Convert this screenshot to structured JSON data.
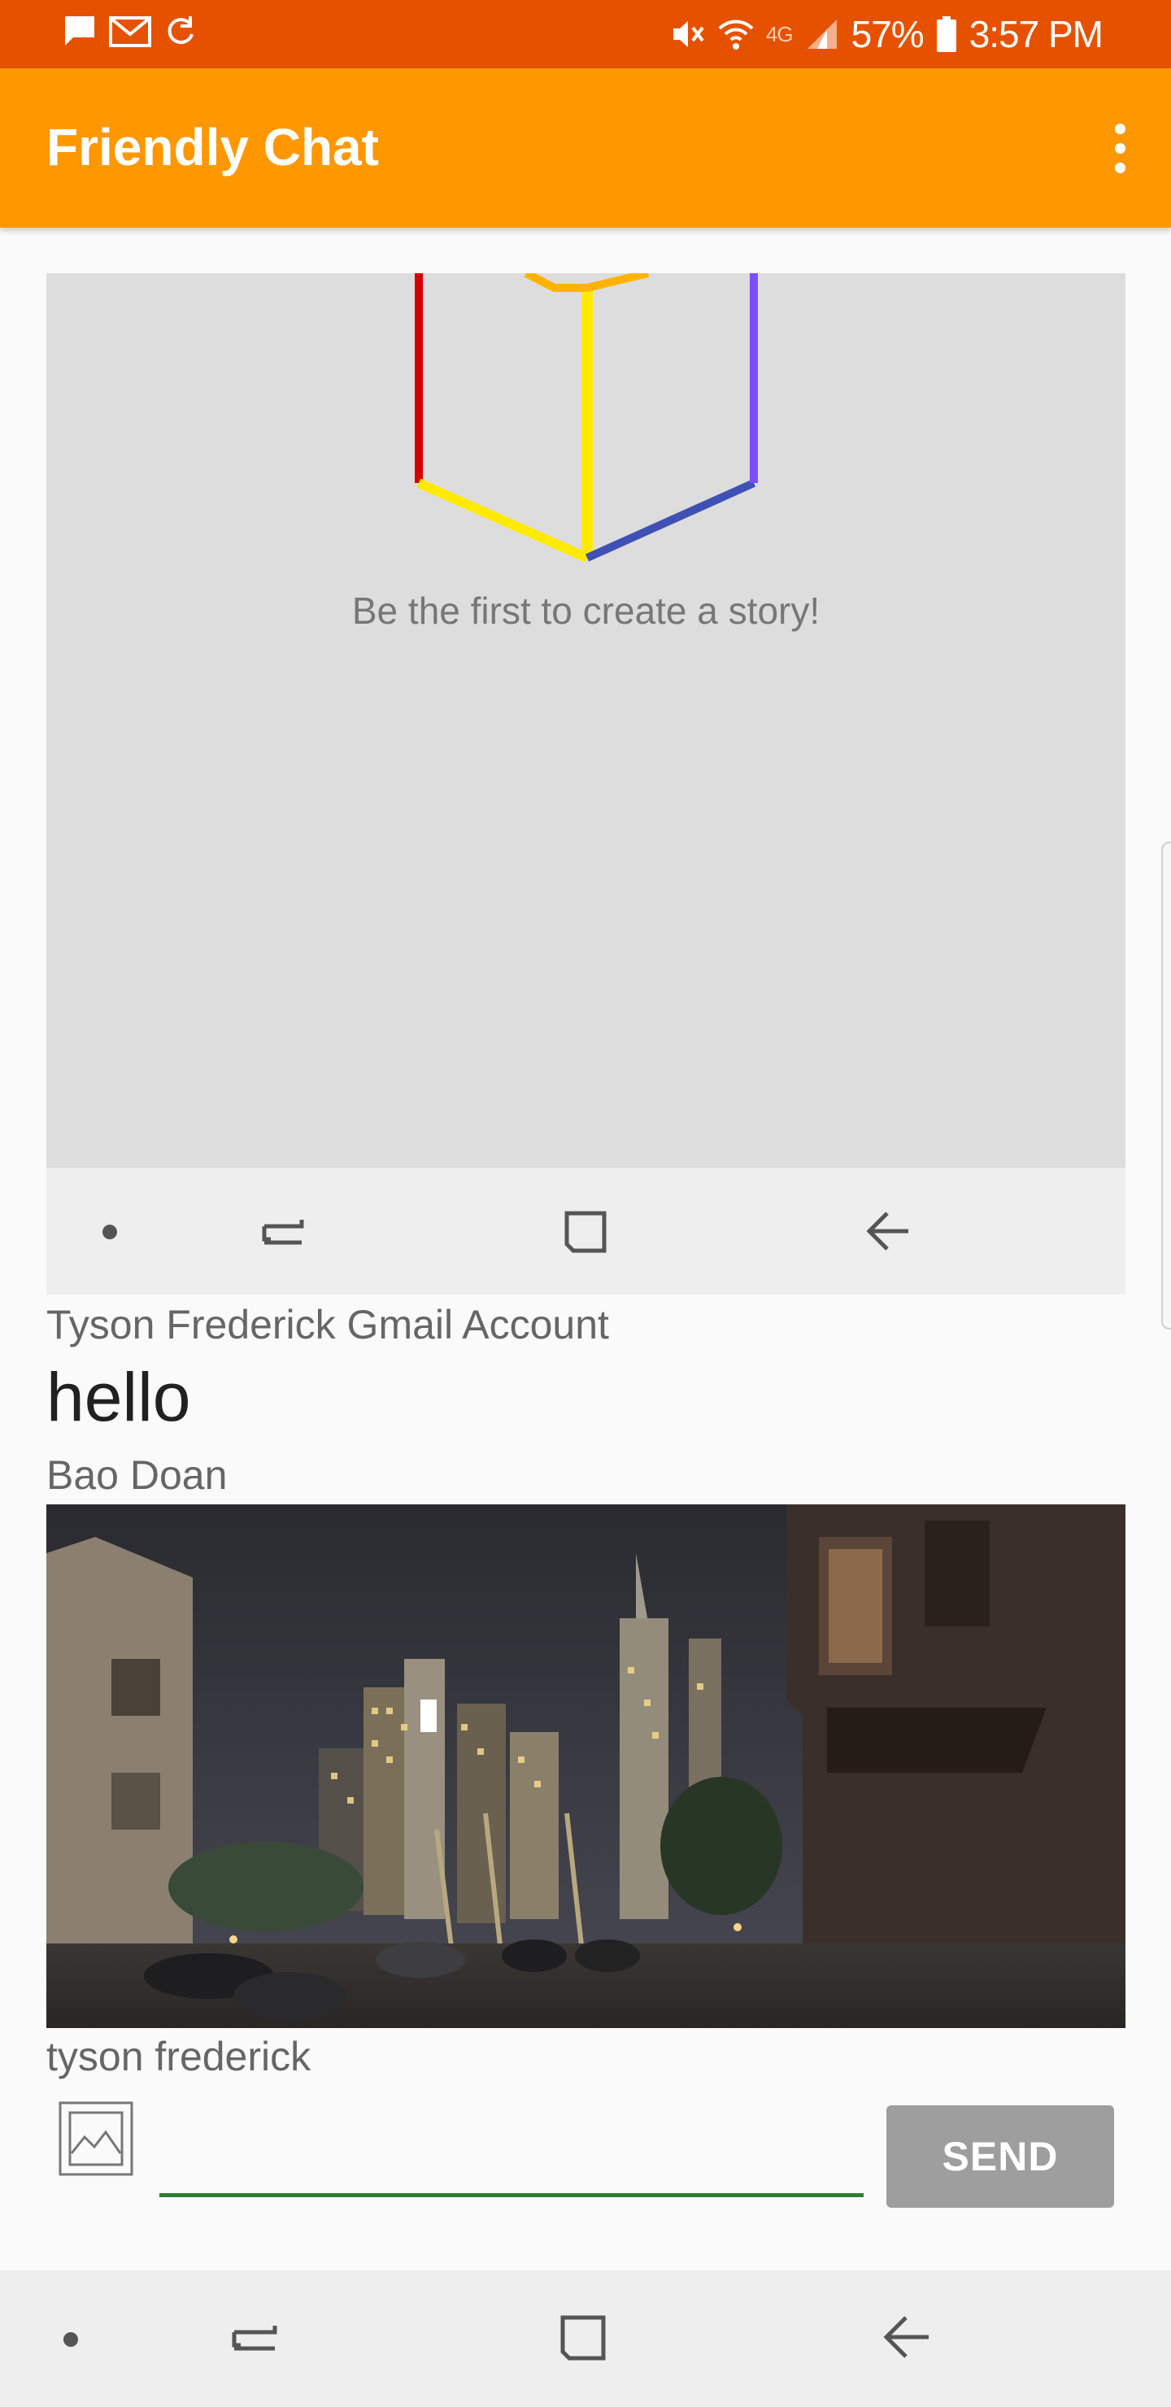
{
  "status_bar": {
    "battery": "57%",
    "time": "3:57 PM",
    "network": "4G",
    "icons_left": [
      "message-icon",
      "gmail-icon",
      "sync-icon"
    ],
    "icons_right": [
      "mute-icon",
      "wifi-icon",
      "signal-icon",
      "battery-icon"
    ]
  },
  "app_bar": {
    "title": "Friendly Chat",
    "menu_icon": "overflow-menu-icon"
  },
  "messages": [
    {
      "type": "image",
      "content": {
        "story_prompt": "Be the first to create a story!",
        "illustration": "rainbow-cube-icon",
        "nav_icons": [
          "dot-icon",
          "recent-apps-icon",
          "home-icon",
          "back-icon"
        ]
      },
      "sender": "Tyson Frederick Gmail Account"
    },
    {
      "type": "text",
      "text": "hello",
      "sender": "Bao Doan"
    },
    {
      "type": "image",
      "content": {
        "description_icon": "city-night-photo"
      },
      "sender": "tyson frederick"
    }
  ],
  "composer": {
    "add_image_icon": "image-icon",
    "input_value": "",
    "input_placeholder": "",
    "send_label": "SEND"
  },
  "system_nav": {
    "icons": [
      "dot-icon",
      "recent-apps-icon",
      "home-icon",
      "back-icon"
    ]
  },
  "colors": {
    "status_bar": "#e65100",
    "app_bar": "#ff9800",
    "input_underline": "#2e7d32",
    "send_button": "#9e9e9e"
  }
}
